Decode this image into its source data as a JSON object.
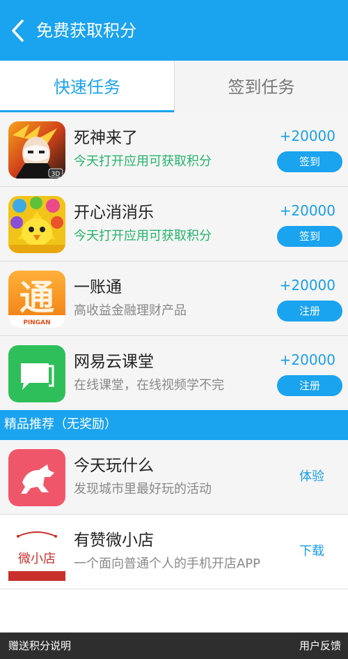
{
  "header": {
    "title": "免费获取积分",
    "back_icon": "chevron-left-icon"
  },
  "tabs": [
    {
      "label": "快速任务",
      "active": true
    },
    {
      "label": "签到任务",
      "active": false
    }
  ],
  "tasks": [
    {
      "name": "死神来了",
      "desc": "今天打开应用可获取积分",
      "points": "+20000",
      "action": "签到",
      "icon": "bleach-game-icon",
      "badge": "3D"
    },
    {
      "name": "开心消消乐",
      "desc": "今天打开应用可获取积分",
      "points": "+20000",
      "action": "签到",
      "icon": "happy-match-game-icon"
    },
    {
      "name": "一账通",
      "desc": "高收益金融理财产品",
      "points": "+20000",
      "action": "注册",
      "icon": "pingan-app-icon",
      "brand": "PINGAN",
      "glyph": "通"
    },
    {
      "name": "网易云课堂",
      "desc": "在线课堂，在线视频学不完",
      "points": "+20000",
      "action": "注册",
      "icon": "netease-study-icon"
    }
  ],
  "recommend": {
    "title": "精品推荐（无奖励）",
    "items": [
      {
        "name": "今天玩什么",
        "desc": "发现城市里最好玩的活动",
        "action": "体验",
        "icon": "horse-app-icon"
      },
      {
        "name": "有赞微小店",
        "desc": "一个面向普通个人的手机开店APP",
        "action": "下载",
        "icon": "weixiaodian-app-icon",
        "icon_text": "微小店"
      }
    ]
  },
  "footer": {
    "left": "赠送积分说明",
    "right": "用户反馈"
  },
  "colors": {
    "accent": "#1aa3ef",
    "green": "#26b36b",
    "footer": "#2e2e2e"
  }
}
